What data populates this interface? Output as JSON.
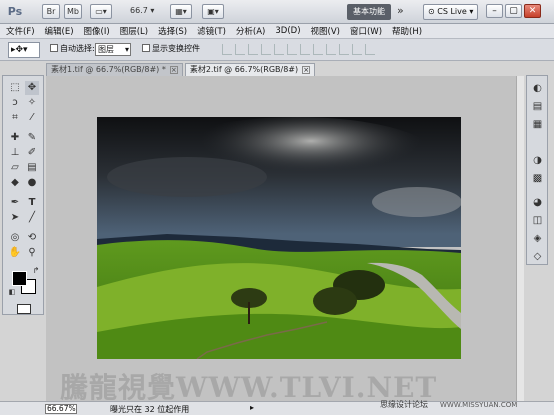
{
  "appbar": {
    "logo": "Ps",
    "br_label": "Br",
    "mb_label": "Mb",
    "zoom": "66.7",
    "workspace_label": "基本功能",
    "cslive_label": "CS Live"
  },
  "menu": [
    "文件(F)",
    "编辑(E)",
    "图像(I)",
    "图层(L)",
    "选择(S)",
    "滤镜(T)",
    "分析(A)",
    "3D(D)",
    "视图(V)",
    "窗口(W)",
    "帮助(H)"
  ],
  "options": {
    "auto_select_label": "自动选择:",
    "auto_select_value": "图层",
    "show_transform_label": "显示变换控件"
  },
  "tabs": [
    {
      "label": "素材1.tif @ 66.7%(RGB/8#) *"
    },
    {
      "label": "素材2.tif @ 66.7%(RGB/8#)"
    }
  ],
  "status": {
    "zoom": "66.67%",
    "message": "曝光只在 32 位起作用"
  },
  "watermark": {
    "text": "騰龍視覺WWW.TLVI.NET",
    "site_cn": "思缘设计论坛",
    "site_url": "WWW.MISSYUAN.COM"
  },
  "colors": {
    "foreground": "#000000",
    "background": "#ffffff",
    "workspace_bg": "#5a5f68"
  }
}
